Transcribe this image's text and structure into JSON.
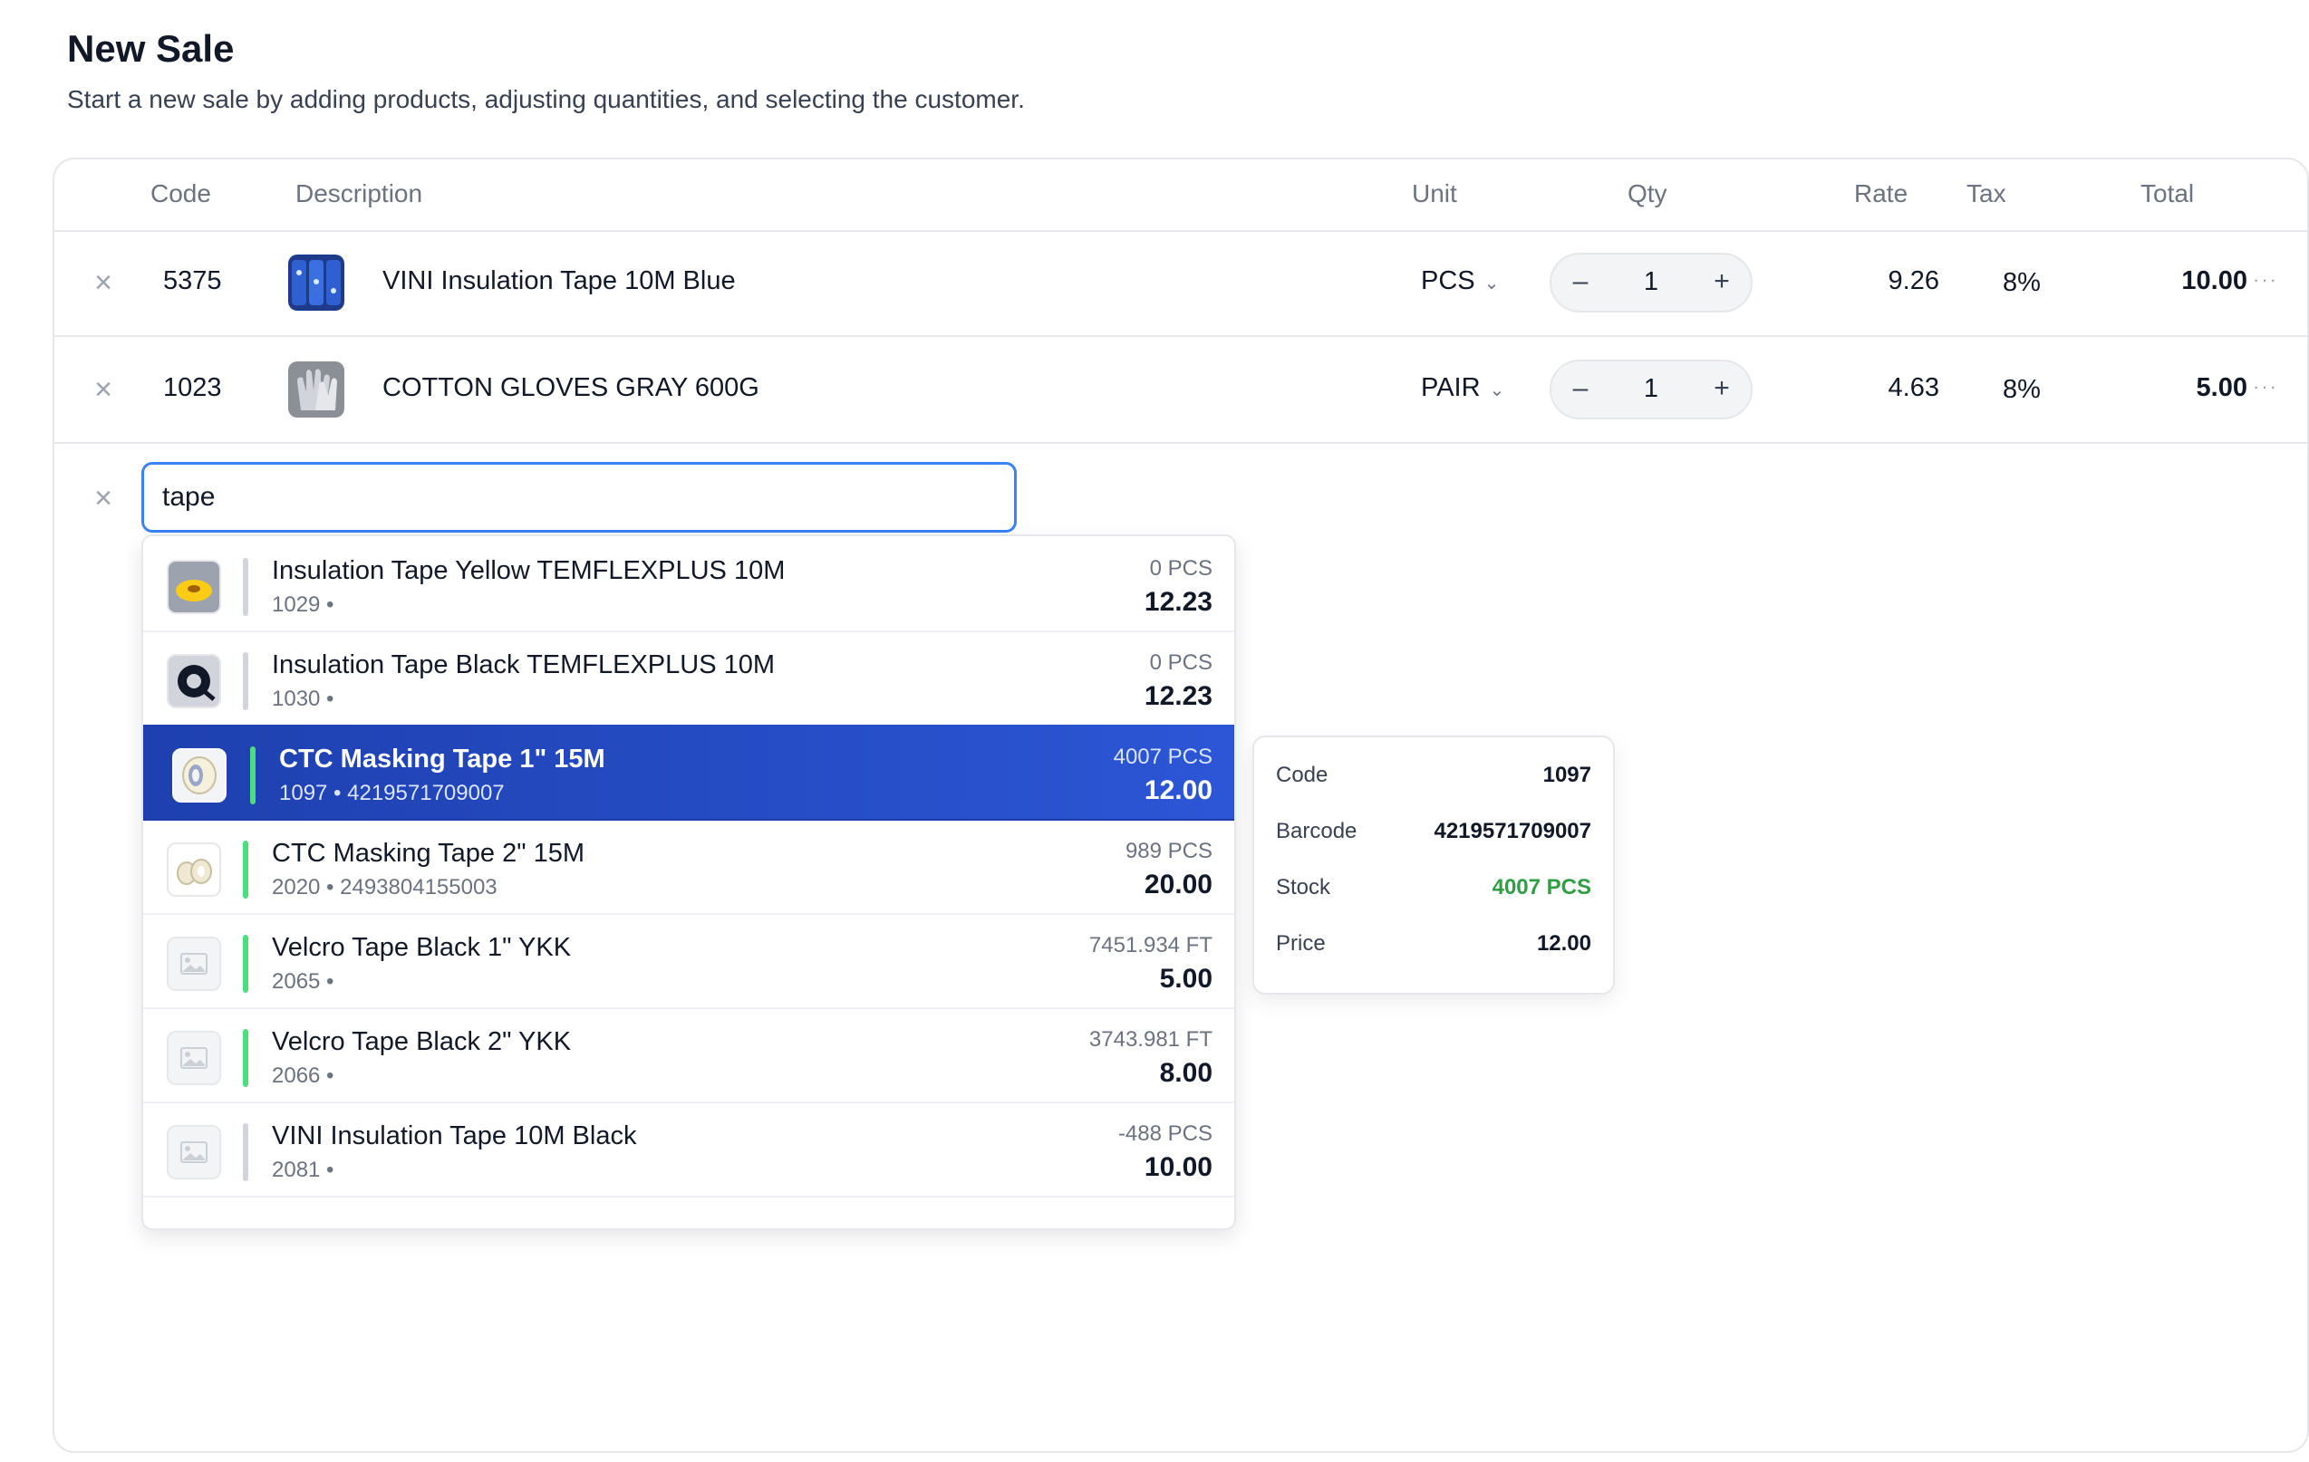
{
  "header": {
    "title": "New Sale",
    "subtitle": "Start a new sale by adding products, adjusting quantities, and selecting the customer."
  },
  "table": {
    "columns": {
      "code": "Code",
      "description": "Description",
      "unit": "Unit",
      "qty": "Qty",
      "rate": "Rate",
      "tax": "Tax",
      "total": "Total"
    },
    "rows": [
      {
        "code": "5375",
        "description": "VINI Insulation Tape 10M Blue",
        "unit": "PCS",
        "qty": "1",
        "rate": "9.26",
        "tax": "8%",
        "total": "10.00",
        "minus": "–",
        "plus": "+",
        "more": "···",
        "remove": "×"
      },
      {
        "code": "1023",
        "description": "COTTON GLOVES GRAY 600G",
        "unit": "PAIR",
        "qty": "1",
        "rate": "4.63",
        "tax": "8%",
        "total": "5.00",
        "minus": "–",
        "plus": "+",
        "more": "···",
        "remove": "×"
      }
    ]
  },
  "search": {
    "value": "tape",
    "remove": "×"
  },
  "dropdown": {
    "selected_index": 2,
    "items": [
      {
        "name": "Insulation Tape Yellow TEMFLEXPLUS 10M",
        "sub": "1029 •",
        "stock": "0 PCS",
        "price": "12.23",
        "bar_color": "#d1d5db",
        "thumb": "yellow-tape"
      },
      {
        "name": "Insulation Tape Black TEMFLEXPLUS 10M",
        "sub": "1030 •",
        "stock": "0 PCS",
        "price": "12.23",
        "bar_color": "#d1d5db",
        "thumb": "black-tape"
      },
      {
        "name": "CTC Masking Tape 1\" 15M",
        "sub": "1097 • 4219571709007",
        "stock": "4007 PCS",
        "price": "12.00",
        "bar_color": "#4ade80",
        "thumb": "masking-tape"
      },
      {
        "name": "CTC Masking Tape 2\" 15M",
        "sub": "2020 • 2493804155003",
        "stock": "989 PCS",
        "price": "20.00",
        "bar_color": "#4ade80",
        "thumb": "masking-tape-2"
      },
      {
        "name": "Velcro Tape Black 1\" YKK",
        "sub": "2065 •",
        "stock": "7451.934 FT",
        "price": "5.00",
        "bar_color": "#4ade80",
        "thumb": "placeholder"
      },
      {
        "name": "Velcro Tape Black 2\" YKK",
        "sub": "2066 •",
        "stock": "3743.981 FT",
        "price": "8.00",
        "bar_color": "#4ade80",
        "thumb": "placeholder"
      },
      {
        "name": "VINI Insulation Tape 10M Black",
        "sub": "2081 •",
        "stock": "-488 PCS",
        "price": "10.00",
        "bar_color": "#d1d5db",
        "thumb": "placeholder"
      }
    ]
  },
  "detail": {
    "code_label": "Code",
    "code_value": "1097",
    "barcode_label": "Barcode",
    "barcode_value": "4219571709007",
    "stock_label": "Stock",
    "stock_value": "4007 PCS",
    "price_label": "Price",
    "price_value": "12.00"
  },
  "colors": {
    "accent": "#2c56d6",
    "focus_border": "#3b82f6",
    "stock_positive": "#2f9e44",
    "in_stock_bar": "#4ade80",
    "out_of_stock_bar": "#d1d5db"
  }
}
